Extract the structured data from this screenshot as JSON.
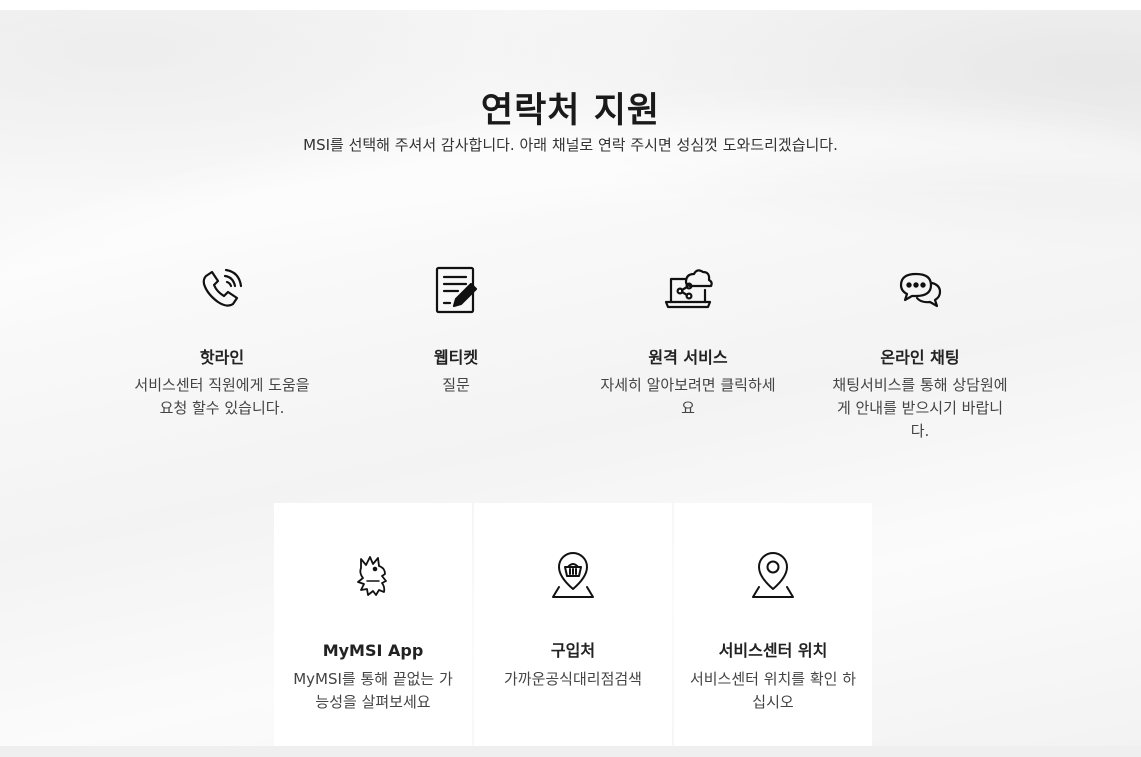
{
  "header": {
    "title": "연락처 지원",
    "subtitle": "MSI를 선택해 주셔서 감사합니다. 아래 채널로 연락 주시면 성심껏 도와드리겠습니다."
  },
  "services": [
    {
      "icon": "phone-icon",
      "title": "핫라인",
      "description": "서비스센터 직원에게 도움을 요청 할수 있습니다."
    },
    {
      "icon": "ticket-edit-icon",
      "title": "웹티켓",
      "description": "질문"
    },
    {
      "icon": "remote-service-icon",
      "title": "원격 서비스",
      "description": "자세히 알아보려면 클릭하세요"
    },
    {
      "icon": "chat-icon",
      "title": "온라인 채팅",
      "description": "채팅서비스를 통해 상담원에게 안내를 받으시기 바랍니다."
    }
  ],
  "cards": [
    {
      "icon": "msi-dragon-icon",
      "title": "MyMSI App",
      "description": "MyMSI를 통해 끝없는 가능성을 살펴보세요"
    },
    {
      "icon": "shop-location-icon",
      "title": "구입처",
      "description": "가까운공식대리점검색"
    },
    {
      "icon": "map-pin-icon",
      "title": "서비스센터 위치",
      "description": "서비스센터 위치를 확인 하십시오"
    }
  ]
}
